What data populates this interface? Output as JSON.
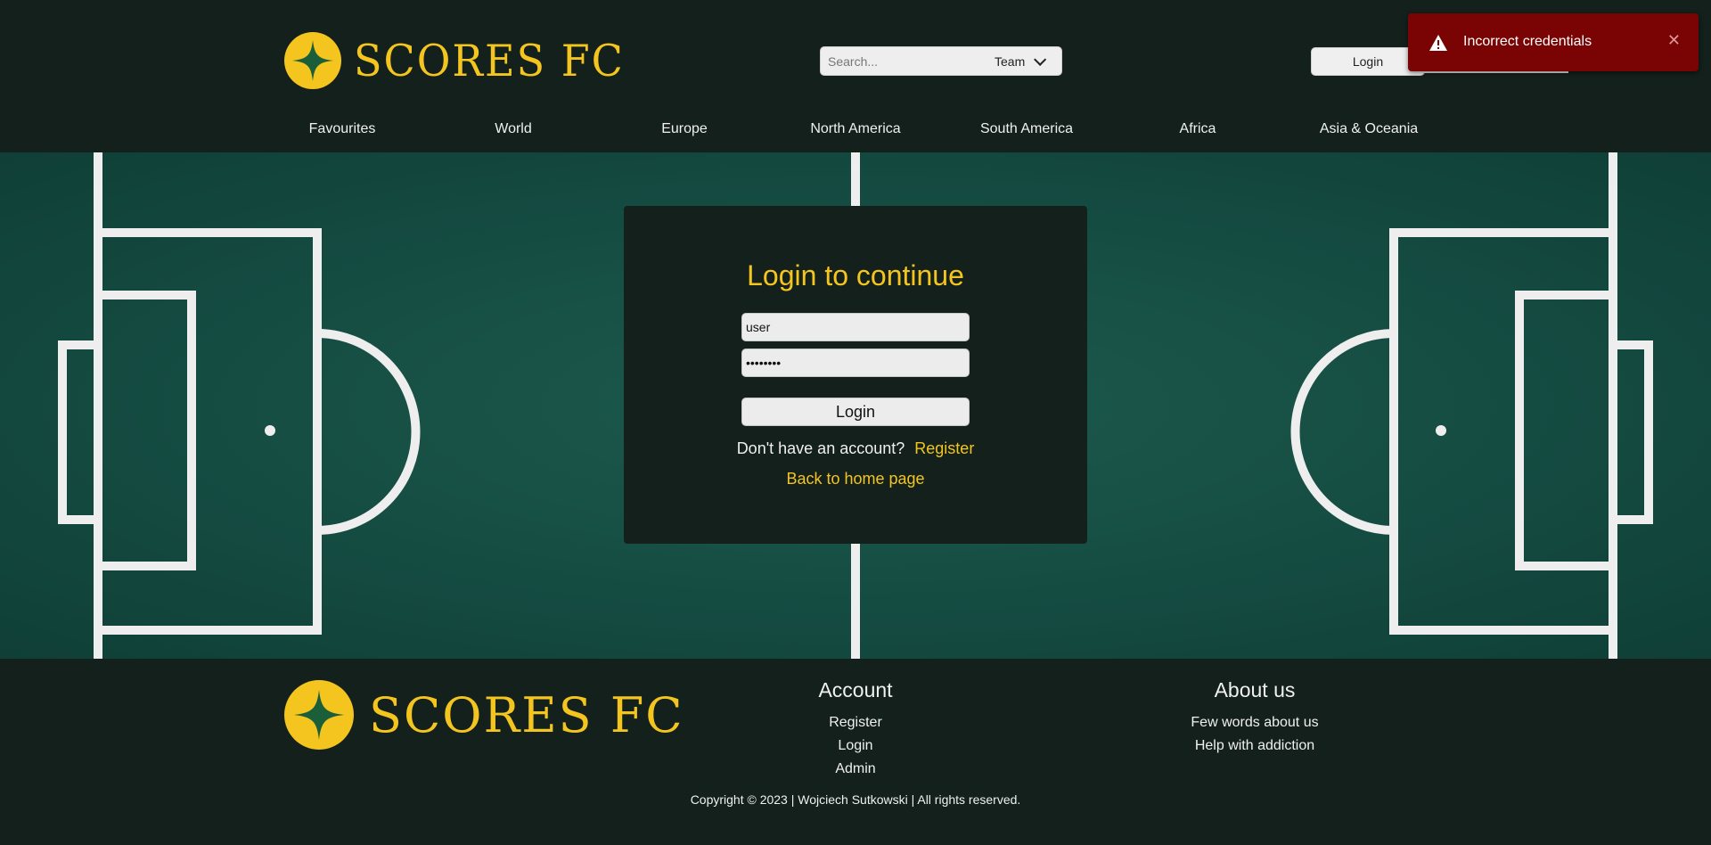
{
  "header": {
    "brand": "SCORES FC",
    "search": {
      "placeholder": "Search...",
      "filter_value": "Team"
    },
    "login_label": "Login"
  },
  "nav": {
    "items": [
      "Favourites",
      "World",
      "Europe",
      "North America",
      "South America",
      "Africa",
      "Asia & Oceania"
    ]
  },
  "toast": {
    "message": "Incorrect credentials",
    "close": "✕",
    "color": "#7a0404"
  },
  "login_card": {
    "title": "Login to continue",
    "username_value": "user",
    "password_value": "••••••••",
    "submit_label": "Login",
    "register_prompt": "Don't have an account?",
    "register_link": "Register",
    "home_link": "Back to home page"
  },
  "footer": {
    "brand": "SCORES FC",
    "account": {
      "heading": "Account",
      "links": [
        "Register",
        "Login",
        "Admin"
      ]
    },
    "about": {
      "heading": "About us",
      "links": [
        "Few words about us",
        "Help with addiction"
      ]
    },
    "copyright": "Copyright © 2023 | Wojciech Sutkowski | All rights reserved."
  },
  "colors": {
    "background": "#13201c",
    "accent": "#f4c51f",
    "pitch": "#1d5a4d"
  },
  "icons": {
    "logo": "star-logo-icon",
    "warning": "warning-icon",
    "dropdown": "chevron-down-icon"
  }
}
